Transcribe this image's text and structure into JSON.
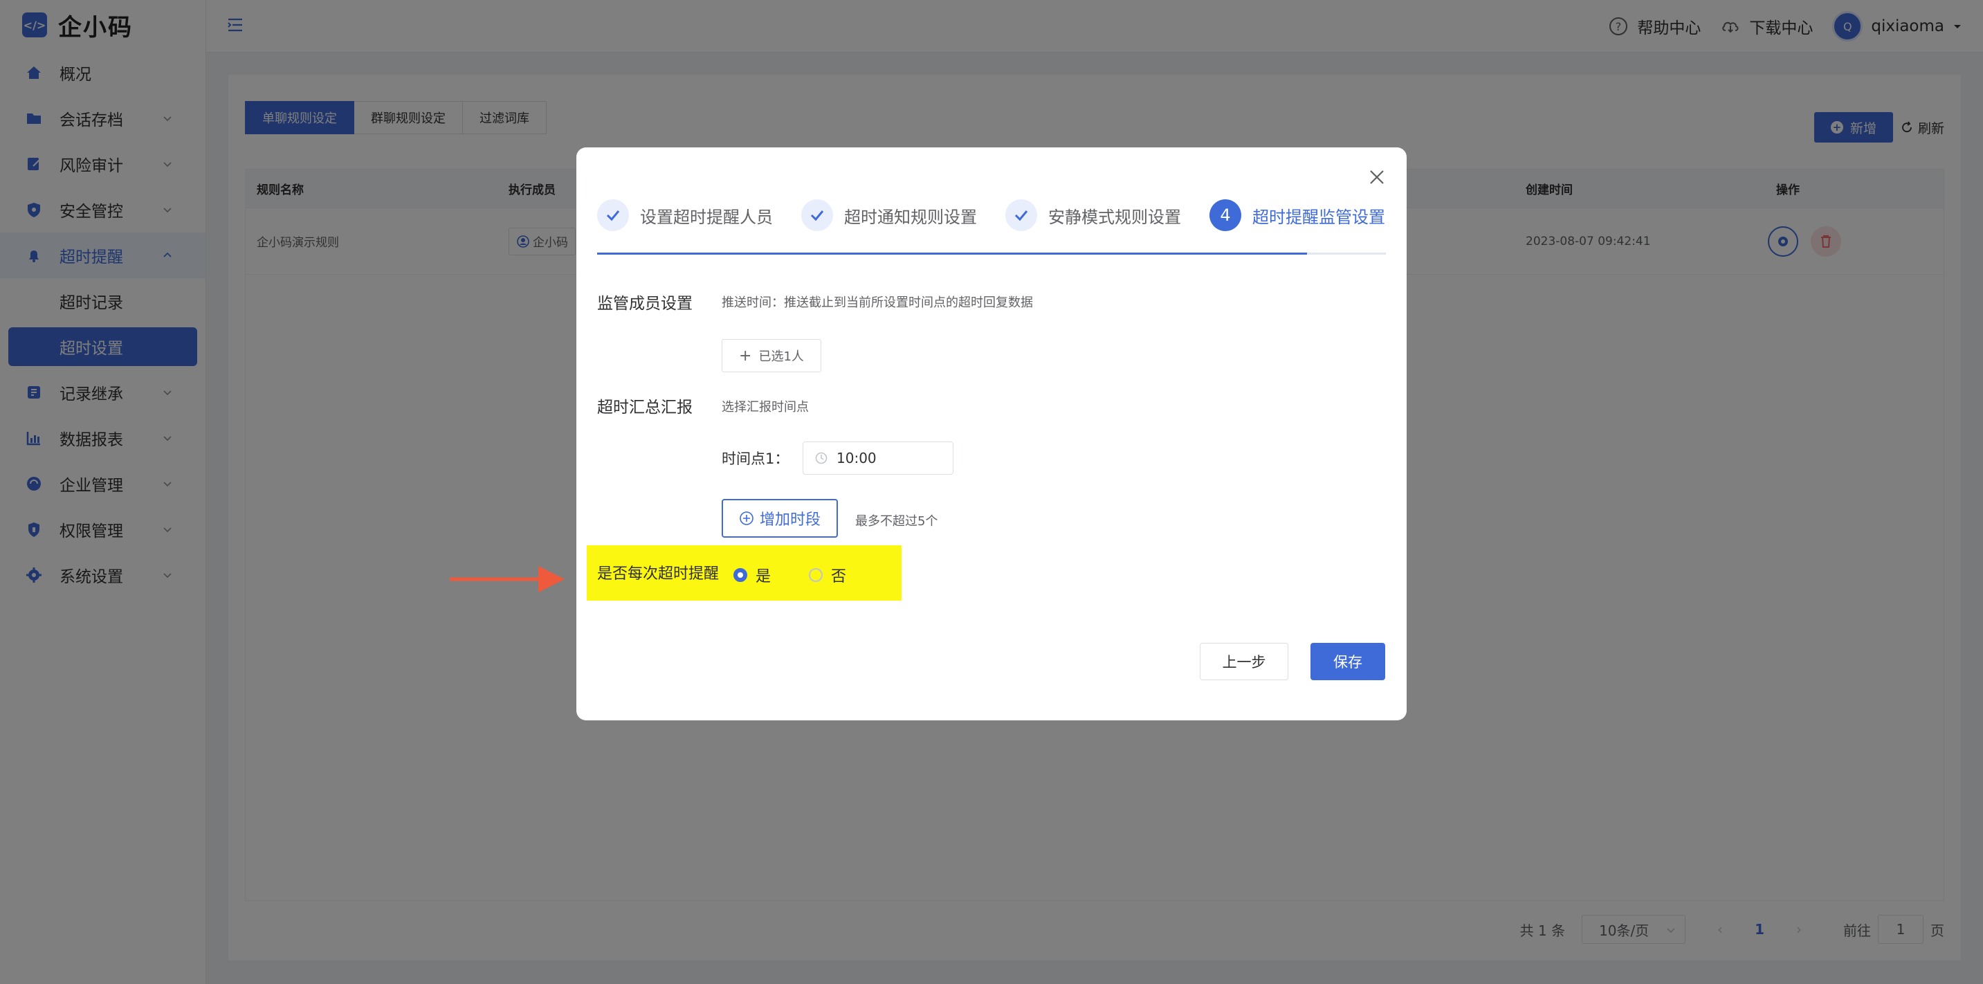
{
  "app": {
    "logo_mark": "</>",
    "logo_text": "企小码"
  },
  "colors": {
    "primary": "#3f6bd8",
    "highlight": "#fbf711",
    "arrow": "#f05a3c"
  },
  "sidebar": {
    "items": [
      {
        "label": "概况",
        "icon": "home-icon"
      },
      {
        "label": "会话存档",
        "icon": "folder-icon"
      },
      {
        "label": "风险审计",
        "icon": "audit-icon"
      },
      {
        "label": "安全管控",
        "icon": "shield-icon"
      },
      {
        "label": "超时提醒",
        "icon": "bell-icon"
      },
      {
        "label": "超时记录"
      },
      {
        "label": "超时设置"
      },
      {
        "label": "记录继承",
        "icon": "inherit-icon"
      },
      {
        "label": "数据报表",
        "icon": "chart-icon"
      },
      {
        "label": "企业管理",
        "icon": "enterprise-icon"
      },
      {
        "label": "权限管理",
        "icon": "permission-icon"
      },
      {
        "label": "系统设置",
        "icon": "gear-icon"
      }
    ]
  },
  "header": {
    "help": "帮助中心",
    "download": "下载中心",
    "avatar_initial": "Q",
    "username": "qixiaoma"
  },
  "tabs": [
    {
      "label": "单聊规则设定"
    },
    {
      "label": "群聊规则设定"
    },
    {
      "label": "过滤词库"
    }
  ],
  "toolbar": {
    "add_label": "新增",
    "refresh_label": "刷新"
  },
  "table": {
    "columns": [
      "规则名称",
      "执行成员",
      "创建时间",
      "操作"
    ],
    "rows": [
      {
        "name": "企小码演示规则",
        "member": "企小码",
        "created": "2023-08-07 09:42:41"
      }
    ]
  },
  "pager": {
    "total": "共 1 条",
    "page_size": "10条/页",
    "current": "1",
    "goto_prefix": "前往",
    "goto_value": "1",
    "goto_suffix": "页"
  },
  "modal": {
    "steps": [
      {
        "label": "设置超时提醒人员",
        "status": "done"
      },
      {
        "label": "超时通知规则设置",
        "status": "done"
      },
      {
        "label": "安静模式规则设置",
        "status": "done"
      },
      {
        "label": "超时提醒监管设置",
        "status": "active",
        "number": "4"
      }
    ],
    "supervisor_label": "监管成员设置",
    "supervisor_hint": "推送时间：推送截止到当前所设置时间点的超时回复数据",
    "selected_btn": "已选1人",
    "summary_label": "超时汇总汇报",
    "summary_hint": "选择汇报时间点",
    "timepoint_label": "时间点1：",
    "timepoint_value": "10:00",
    "add_period_btn": "增加时段",
    "add_period_hint": "最多不超过5个",
    "each_remind_label": "是否每次超时提醒",
    "option_yes": "是",
    "option_no": "否",
    "selected_option": "是",
    "prev_btn": "上一步",
    "save_btn": "保存"
  }
}
